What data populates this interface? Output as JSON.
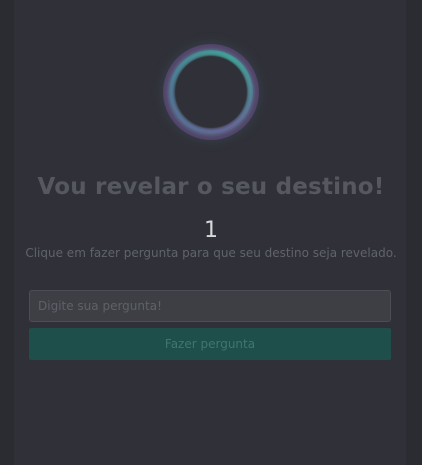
{
  "header": {
    "title": "Vou revelar o seu destino!",
    "counter": "1",
    "subtitle": "Clique em fazer pergunta para que seu destino seja revelado."
  },
  "form": {
    "question_placeholder": "Digite sua pergunta!",
    "question_value": "",
    "ask_button_label": "Fazer pergunta"
  },
  "colors": {
    "background": "#2b2c31",
    "panel": "#303138",
    "button": "#1e4f4a",
    "orb_teal": "#5ac8be",
    "orb_purple": "#7a5aa0"
  },
  "icons": {
    "orb": "crystal-ball-orb-icon"
  }
}
